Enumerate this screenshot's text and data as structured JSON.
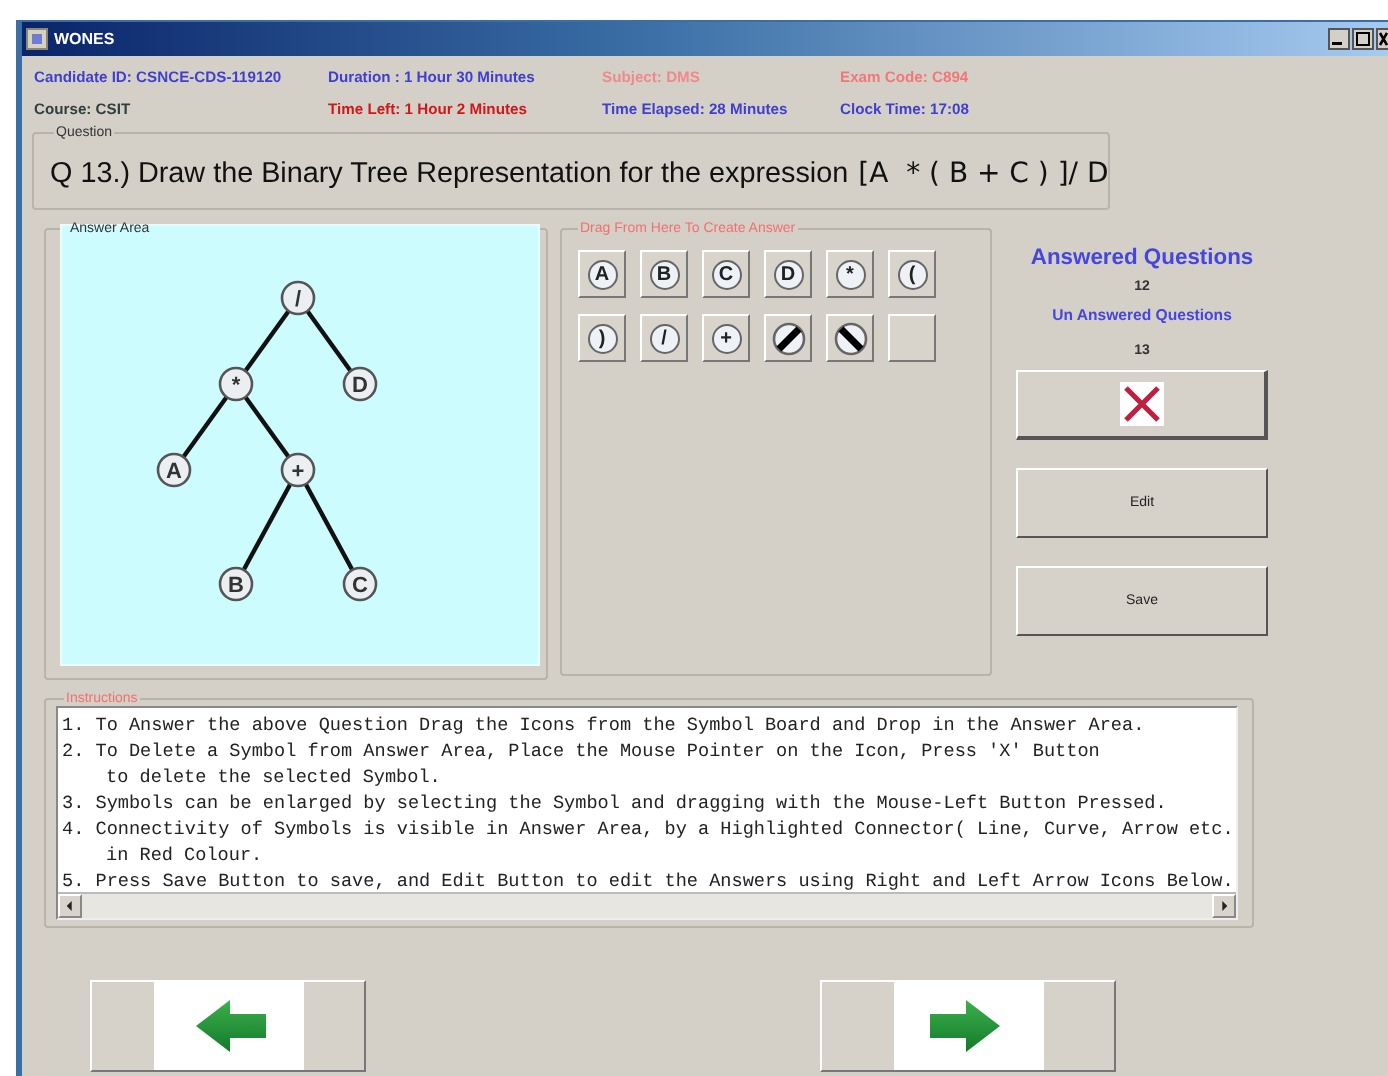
{
  "window": {
    "title": "WONES"
  },
  "header": [
    {
      "text": "Candidate ID: CSNCE-CDS-119120",
      "color": "#3f3fd0"
    },
    {
      "text": "Duration : 1 Hour 30 Minutes",
      "color": "#3f3fd0"
    },
    {
      "text": "Subject: DMS",
      "color": "#f08a8a"
    },
    {
      "text": "Exam Code: C894",
      "color": "#f07878"
    },
    {
      "text": "Course: CSIT",
      "color": "#2f3f3f"
    },
    {
      "text": "Time Left: 1 Hour 2 Minutes",
      "color": "#d01818"
    },
    {
      "text": "Time Elapsed: 28 Minutes",
      "color": "#3f3fd0"
    },
    {
      "text": "Clock Time: 17:08",
      "color": "#3f3fd0"
    }
  ],
  "question": {
    "legend": "Question",
    "text": "Q 13.) Draw the Binary Tree Representation for the expression",
    "expression": "[A  * ( B + C ) ]/ D"
  },
  "answer_area": {
    "legend": "Answer Area",
    "tree": {
      "label": "/",
      "children": [
        {
          "label": "*",
          "children": [
            {
              "label": "A"
            },
            {
              "label": "+",
              "children": [
                {
                  "label": "B"
                },
                {
                  "label": "C"
                }
              ]
            }
          ]
        },
        {
          "label": "D"
        }
      ]
    }
  },
  "palette": {
    "legend": "Drag From Here To Create Answer",
    "symbols": [
      {
        "kind": "symbol",
        "label": "A"
      },
      {
        "kind": "symbol",
        "label": "B"
      },
      {
        "kind": "symbol",
        "label": "C"
      },
      {
        "kind": "symbol",
        "label": "D"
      },
      {
        "kind": "symbol",
        "label": "*"
      },
      {
        "kind": "symbol",
        "label": "("
      },
      {
        "kind": "symbol",
        "label": ")"
      },
      {
        "kind": "symbol",
        "label": "/"
      },
      {
        "kind": "symbol",
        "label": "+"
      },
      {
        "kind": "line-forward"
      },
      {
        "kind": "line-back"
      },
      {
        "kind": "blank"
      }
    ]
  },
  "stats": {
    "answered_label": "Answered Questions",
    "answered": "12",
    "unanswered_label": "Un Answered Questions",
    "unanswered": "13"
  },
  "buttons": [
    {
      "kind": "delete"
    },
    {
      "kind": "text",
      "label": "Edit"
    },
    {
      "kind": "text",
      "label": "Save"
    }
  ],
  "instructions": {
    "legend": "Instructions",
    "items": [
      {
        "lines": [
          "1. To Answer the above Question Drag the Icons from the Symbol Board and Drop in the Answer Area."
        ]
      },
      {
        "lines": [
          "2. To Delete a Symbol from Answer Area, Place the Mouse Pointer on the Icon, Press 'X' Button",
          "to delete the selected Symbol."
        ]
      },
      {
        "lines": [
          "3. Symbols can be enlarged by selecting the Symbol and dragging with the Mouse-Left Button Pressed."
        ]
      },
      {
        "lines": [
          "4. Connectivity of Symbols is visible in Answer Area, by a Highlighted Connector( Line, Curve, Arrow etc.",
          "in Red Colour."
        ]
      },
      {
        "lines": [
          "5. Press Save Button to save, and Edit Button to edit the Answers using Right and Left Arrow Icons Below."
        ]
      }
    ]
  },
  "navigation": [
    {
      "kind": "previous"
    },
    {
      "kind": "next"
    }
  ]
}
